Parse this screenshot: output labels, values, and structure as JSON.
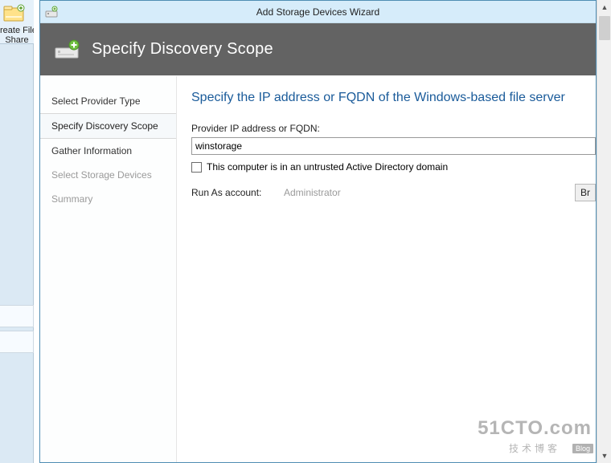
{
  "host": {
    "label_line1": "reate File",
    "label_line2": "Share"
  },
  "wizard": {
    "title": "Add Storage Devices Wizard",
    "banner_title": "Specify Discovery Scope",
    "nav": [
      {
        "label": "Select Provider Type",
        "state": "normal"
      },
      {
        "label": "Specify Discovery Scope",
        "state": "active"
      },
      {
        "label": "Gather Information",
        "state": "normal"
      },
      {
        "label": "Select Storage Devices",
        "state": "disabled"
      },
      {
        "label": "Summary",
        "state": "disabled"
      }
    ],
    "content": {
      "heading": "Specify the IP address or FQDN of the Windows-based file server",
      "fqdn_label": "Provider IP address or FQDN:",
      "fqdn_value": "winstorage",
      "untrusted_label": "This computer is in an untrusted Active Directory domain",
      "untrusted_checked": false,
      "runas_label": "Run As account:",
      "runas_value": "Administrator",
      "browse_label": "Br"
    }
  },
  "watermark": {
    "top": "51CTO.com",
    "bottom": "技术博客",
    "badge": "Blog"
  }
}
